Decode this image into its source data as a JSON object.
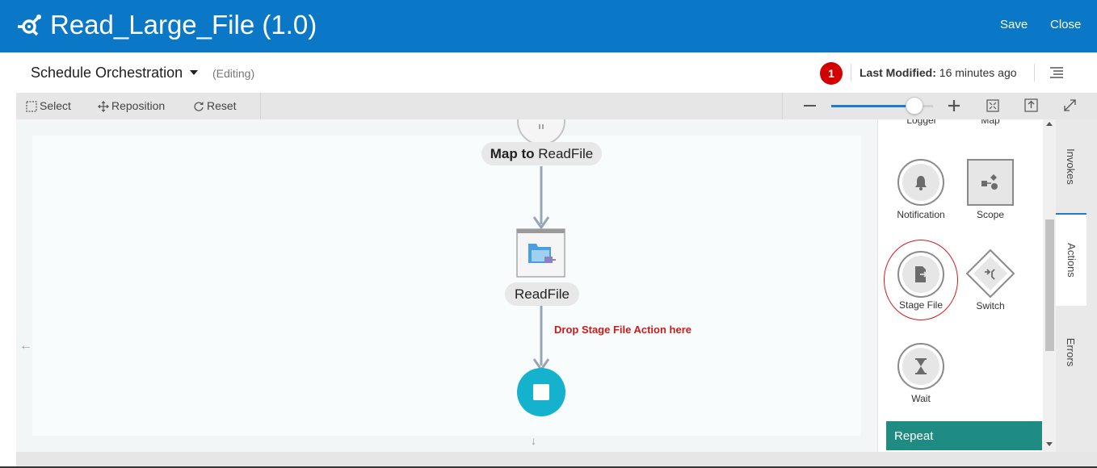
{
  "header": {
    "title": "Read_Large_File (1.0)",
    "save_label": "Save",
    "close_label": "Close",
    "background": "#0a78c6"
  },
  "subheader": {
    "schedule_label": "Schedule Orchestration",
    "status_label": "(Editing)",
    "error_count": "1",
    "last_modified_label": "Last Modified:",
    "last_modified_value": "16 minutes ago"
  },
  "toolbar": {
    "select_label": "Select",
    "reposition_label": "Reposition",
    "reset_label": "Reset",
    "zoom_level": 0.82
  },
  "canvas": {
    "map_label_bold": "Map to",
    "map_label_rest": " ReadFile",
    "readfile_label": "ReadFile",
    "drop_hint": "Drop Stage File Action here"
  },
  "palette": {
    "items": [
      {
        "label": "Logger",
        "icon": "logger-icon"
      },
      {
        "label": "Map",
        "icon": "map-icon"
      },
      {
        "label": "Notification",
        "icon": "bell-icon"
      },
      {
        "label": "Scope",
        "icon": "scope-icon"
      },
      {
        "label": "Stage File",
        "icon": "stage-file-icon"
      },
      {
        "label": "Switch",
        "icon": "switch-icon"
      },
      {
        "label": "Wait",
        "icon": "hourglass-icon"
      }
    ],
    "section_header": "Repeat",
    "section_color": "#1e8c82"
  },
  "side_tabs": {
    "invokes": "Invokes",
    "actions": "Actions",
    "errors": "Errors"
  }
}
